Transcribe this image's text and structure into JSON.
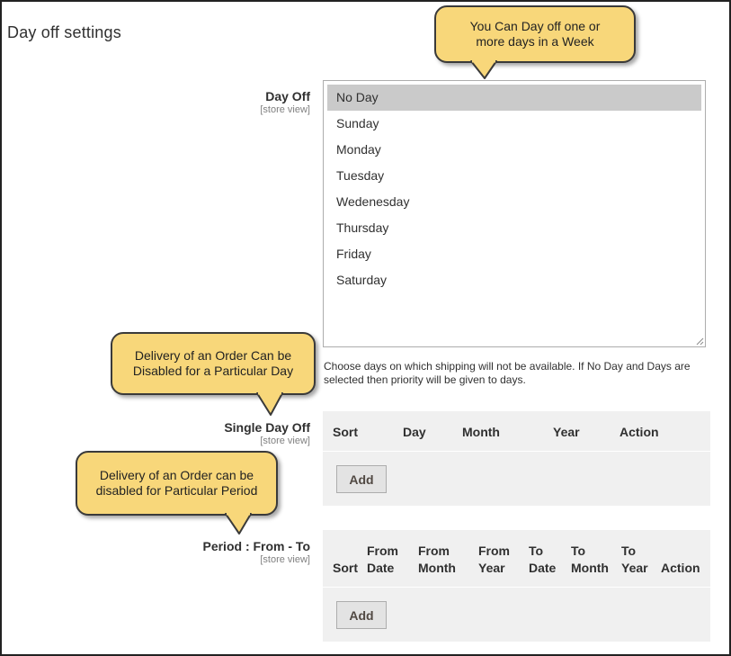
{
  "section_title": "Day off settings",
  "day_off": {
    "label": "Day Off",
    "scope": "[store view]",
    "options": [
      "No Day",
      "Sunday",
      "Monday",
      "Tuesday",
      "Wedenesday",
      "Thursday",
      "Friday",
      "Saturday"
    ],
    "selected": "No Day",
    "note": "Choose days on which shipping will not be available. If No Day and Days are selected then priority will be given to days."
  },
  "single_day_off": {
    "label": "Single Day Off",
    "scope": "[store view]",
    "columns": [
      "Sort",
      "Day",
      "Month",
      "Year",
      "Action"
    ],
    "add_label": "Add"
  },
  "period": {
    "label": "Period : From - To",
    "scope": "[store view]",
    "columns": [
      {
        "top": "",
        "bottom": "Sort"
      },
      {
        "top": "From",
        "bottom": "Date"
      },
      {
        "top": "From",
        "bottom": "Month"
      },
      {
        "top": "From",
        "bottom": "Year"
      },
      {
        "top": "To",
        "bottom": "Date"
      },
      {
        "top": "To",
        "bottom": "Month"
      },
      {
        "top": "To",
        "bottom": "Year"
      },
      {
        "top": "",
        "bottom": "Action"
      }
    ],
    "add_label": "Add"
  },
  "callouts": {
    "day_off_tip": "You Can Day off one or more days in a Week",
    "single_day_tip": "Delivery of an Order Can be Disabled for a Particular Day",
    "period_tip": "Delivery of an Order can be disabled for Particular Period"
  },
  "colors": {
    "callout_fill": "#f8d77a",
    "grid_background": "#f0f0f0",
    "selected_option": "#cacaca"
  }
}
